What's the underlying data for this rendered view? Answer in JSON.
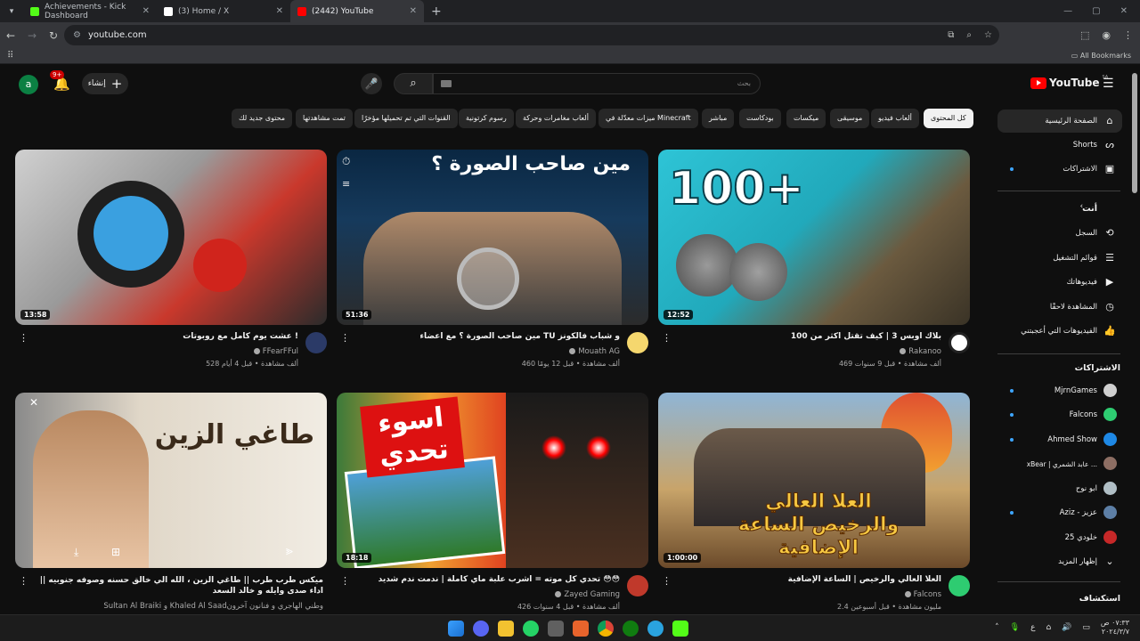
{
  "browser": {
    "tabs": [
      {
        "title": "Achievements - Kick Dashboard",
        "color": "#53fc18"
      },
      {
        "title": "(3) Home / X",
        "color": "#ffffff"
      },
      {
        "title": "(2442) YouTube",
        "color": "#ff0000",
        "active": true
      }
    ],
    "url": "youtube.com",
    "all_bookmarks": "All Bookmarks"
  },
  "header": {
    "avatar_letter": "a",
    "notif_badge": "9+",
    "create_label": "إنشاء",
    "search_placeholder": "بحث",
    "logo_text": "YouTube",
    "logo_region": "SA"
  },
  "chips": [
    {
      "label": "كل المحتوى",
      "active": true
    },
    {
      "label": "ألعاب فيديو"
    },
    {
      "label": "موسيقى"
    },
    {
      "label": "ميكسات"
    },
    {
      "label": "بودكاست"
    },
    {
      "label": "مباشر"
    },
    {
      "label": "ميزات معدّلة في Minecraft"
    },
    {
      "label": "ألعاب مغامرات وحركة"
    },
    {
      "label": "رسوم كرتونية"
    },
    {
      "label": "القنوات التي تم تحميلها مؤخرًا"
    },
    {
      "label": "تمت مشاهدتها"
    },
    {
      "label": "محتوى جديد لك"
    }
  ],
  "sidebar": {
    "main": [
      {
        "label": "الصفحة الرئيسية",
        "icon": "home-icon",
        "active": true
      },
      {
        "label": "Shorts",
        "icon": "shorts-icon"
      },
      {
        "label": "الاشتراكات",
        "icon": "subscriptions-icon",
        "dot": true
      }
    ],
    "you_heading": "أنت",
    "you": [
      {
        "label": "السجل",
        "icon": "history-icon"
      },
      {
        "label": "قوائم التشغيل",
        "icon": "playlists-icon"
      },
      {
        "label": "فيديوهاتك",
        "icon": "your-videos-icon"
      },
      {
        "label": "المشاهدة لاحقًا",
        "icon": "watch-later-icon"
      },
      {
        "label": "الفيديوهات التي أعجبتني",
        "icon": "liked-icon"
      }
    ],
    "subs_heading": "الاشتراكات",
    "subs": [
      {
        "label": "MjrnGames",
        "color": "#cfcfcf"
      },
      {
        "label": "Falcons",
        "color": "#2ecc71"
      },
      {
        "label": "Ahmed Show",
        "color": "#1e88e5"
      },
      {
        "label": "xBear | عابد الشمري ...",
        "color": "#8d6e63"
      },
      {
        "label": "ابو نوح",
        "color": "#b0bec5"
      },
      {
        "label": "Aziz - عزيز",
        "color": "#5d7fa6"
      },
      {
        "label": "خلودي 25",
        "color": "#c62828"
      }
    ],
    "show_more": "إظهار المزيد",
    "explore_heading": "استكشاف"
  },
  "videos": [
    {
      "title": "بلاك اوبس 3 | كيف تقتل اكثر من 100",
      "channel": "Rakanoo",
      "stats": "469 ألف مشاهدة • قبل 9 سنوات",
      "duration": "12:52",
      "thumb_text": "100+",
      "bg": "linear-gradient(135deg,#2ec4d6 0%,#21a9bb 45%,#6b5a3f 70%,#3a3326 100%)",
      "avatar": "#ffffff"
    },
    {
      "title": "مين صاحب الصورة ؟ مع اعضاء TU و شباب فالكونز",
      "channel": "Mouath AG",
      "stats": "460 ألف مشاهدة • قبل 12 يومًا",
      "duration": "51:36",
      "thumb_text": "مين صاحب الصورة ؟",
      "bg": "linear-gradient(180deg,#0a2742 0%,#163a5c 40%,#2b2b2b 100%)",
      "avatar": "#f5d76e"
    },
    {
      "title": "عشت يوم كامل مع روبوتات !",
      "channel": "FFearFFul",
      "stats": "528 ألف مشاهدة • قبل 4 أيام",
      "duration": "13:58",
      "thumb_text": "",
      "bg": "linear-gradient(135deg,#c9c9c9 0%,#8f8f8f 40%,#d63b2f 70%,#2b2b2b 100%)",
      "avatar": "#2b3a67"
    },
    {
      "title": "العلا العالي والرخيص | الساعة الإضافية",
      "channel": "Falcons",
      "stats": "2.4 مليون مشاهدة • قبل أسبوعين",
      "duration": "1:00:00",
      "thumb_text": "العلا العالي والرخيص الساعة الإضافية",
      "bg": "linear-gradient(180deg,#8fb5d6 0%,#c8a46a 55%,#6b4a2a 100%)",
      "avatar": "#2ecc71"
    },
    {
      "title": "تحدي كل موته = اشرب علبة ماي كاملة | ندمت ندم شديد 😳😳",
      "channel": "Zayed Gaming",
      "stats": "426 ألف مشاهدة • قبل 4 سنوات",
      "duration": "18:18",
      "thumb_text": "اسوء تحدي",
      "bg": "linear-gradient(90deg,#3b7a3a 0%,#f0a030 30%,#e04020 55%,#222 100%)",
      "avatar": "#c0392b"
    },
    {
      "title": "ميكس طرب طرب || طاغي الزين ، الله الي خالق حسنه وصوفه جنوبيه || اداء صدى وايله و خالد السعد",
      "channel": "Sultan Al Braiki و Khaled Al Saadوطني الهاجري و فنانون آخرون",
      "stats": "",
      "duration": "",
      "thumb_text": "طاغي الزين",
      "bg": "linear-gradient(90deg,#8a8a8a 0%,#e0d7c8 40%,#f1ece3 100%)",
      "avatar": ""
    }
  ],
  "taskbar": {
    "time": "٠٧:٣٣ ص",
    "date": "٢٠٢٤/٣/٧",
    "lang": "ع"
  }
}
